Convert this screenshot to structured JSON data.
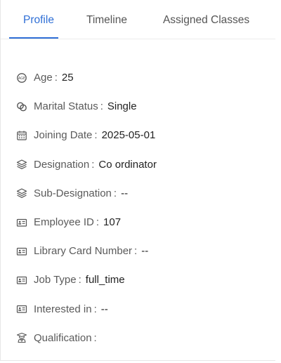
{
  "tabs": [
    {
      "label": "Profile"
    },
    {
      "label": "Timeline"
    },
    {
      "label": "Assigned Classes"
    }
  ],
  "details": [
    {
      "icon": "gauge-icon",
      "label": "Age",
      "value": "25"
    },
    {
      "icon": "rings-icon",
      "label": "Marital Status",
      "value": "Single"
    },
    {
      "icon": "calendar-icon",
      "label": "Joining Date",
      "value": "2025-05-01"
    },
    {
      "icon": "layers-icon",
      "label": "Designation",
      "value": "Co ordinator"
    },
    {
      "icon": "layers-icon",
      "label": "Sub-Designation",
      "value": "--"
    },
    {
      "icon": "id-card-icon",
      "label": "Employee ID",
      "value": "107"
    },
    {
      "icon": "id-card-icon",
      "label": "Library Card Number",
      "value": "--"
    },
    {
      "icon": "id-card-icon",
      "label": "Job Type",
      "value": "full_time"
    },
    {
      "icon": "id-card-icon",
      "label": "Interested in",
      "value": "--"
    },
    {
      "icon": "graduate-icon",
      "label": "Qualification",
      "value": ""
    }
  ],
  "separator": ":",
  "colors": {
    "accent": "#2f6fd6"
  }
}
